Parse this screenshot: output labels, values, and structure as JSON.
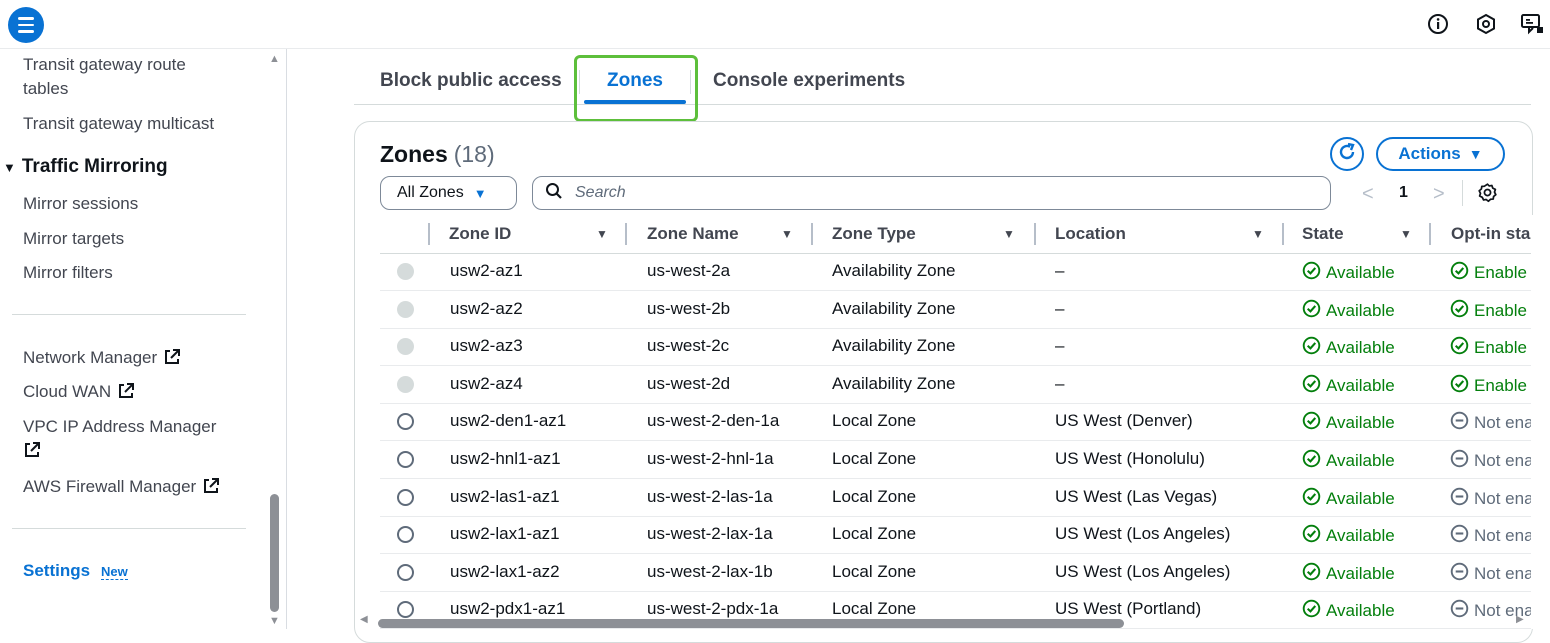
{
  "sidebar": {
    "links_top": [
      {
        "label_line1": "Transit gateway route",
        "label_line2": "tables"
      },
      {
        "label": "Transit gateway multicast"
      }
    ],
    "section": {
      "label": "Traffic Mirroring",
      "caret": "▼"
    },
    "section_items": [
      "Mirror sessions",
      "Mirror targets",
      "Mirror filters"
    ],
    "external_links": [
      {
        "label": "Network Manager"
      },
      {
        "label": "Cloud WAN"
      },
      {
        "label": "VPC IP Address Manager"
      },
      {
        "label": "AWS Firewall Manager"
      }
    ],
    "settings_label": "Settings",
    "settings_badge": "New"
  },
  "tabs": [
    {
      "label": "Block public access",
      "active": false
    },
    {
      "label": "Zones",
      "active": true
    },
    {
      "label": "Console experiments",
      "active": false
    }
  ],
  "panel": {
    "title": "Zones",
    "count": "(18)",
    "actions_label": "Actions",
    "actions_caret": "▼",
    "filter_selected": "All Zones",
    "filter_caret": "▼",
    "search_placeholder": "Search",
    "page_number": "1",
    "prev_glyph": "<",
    "next_glyph": ">"
  },
  "table": {
    "columns": [
      "Zone ID",
      "Zone Name",
      "Zone Type",
      "Location",
      "State",
      "Opt-in sta"
    ],
    "sort_glyph": "▼",
    "rows": [
      {
        "zone_id": "usw2-az1",
        "zone_name": "us-west-2a",
        "zone_type": "Availability Zone",
        "location": "–",
        "state": "Available",
        "opt_in": "Enable",
        "selectable": false,
        "opt_in_enabled": true
      },
      {
        "zone_id": "usw2-az2",
        "zone_name": "us-west-2b",
        "zone_type": "Availability Zone",
        "location": "–",
        "state": "Available",
        "opt_in": "Enable",
        "selectable": false,
        "opt_in_enabled": true
      },
      {
        "zone_id": "usw2-az3",
        "zone_name": "us-west-2c",
        "zone_type": "Availability Zone",
        "location": "–",
        "state": "Available",
        "opt_in": "Enable",
        "selectable": false,
        "opt_in_enabled": true
      },
      {
        "zone_id": "usw2-az4",
        "zone_name": "us-west-2d",
        "zone_type": "Availability Zone",
        "location": "–",
        "state": "Available",
        "opt_in": "Enable",
        "selectable": false,
        "opt_in_enabled": true
      },
      {
        "zone_id": "usw2-den1-az1",
        "zone_name": "us-west-2-den-1a",
        "zone_type": "Local Zone",
        "location": "US West (Denver)",
        "state": "Available",
        "opt_in": "Not ena",
        "selectable": true,
        "opt_in_enabled": false
      },
      {
        "zone_id": "usw2-hnl1-az1",
        "zone_name": "us-west-2-hnl-1a",
        "zone_type": "Local Zone",
        "location": "US West (Honolulu)",
        "state": "Available",
        "opt_in": "Not ena",
        "selectable": true,
        "opt_in_enabled": false
      },
      {
        "zone_id": "usw2-las1-az1",
        "zone_name": "us-west-2-las-1a",
        "zone_type": "Local Zone",
        "location": "US West (Las Vegas)",
        "state": "Available",
        "opt_in": "Not ena",
        "selectable": true,
        "opt_in_enabled": false
      },
      {
        "zone_id": "usw2-lax1-az1",
        "zone_name": "us-west-2-lax-1a",
        "zone_type": "Local Zone",
        "location": "US West (Los Angeles)",
        "state": "Available",
        "opt_in": "Not ena",
        "selectable": true,
        "opt_in_enabled": false
      },
      {
        "zone_id": "usw2-lax1-az2",
        "zone_name": "us-west-2-lax-1b",
        "zone_type": "Local Zone",
        "location": "US West (Los Angeles)",
        "state": "Available",
        "opt_in": "Not ena",
        "selectable": true,
        "opt_in_enabled": false
      },
      {
        "zone_id": "usw2-pdx1-az1",
        "zone_name": "us-west-2-pdx-1a",
        "zone_type": "Local Zone",
        "location": "US West (Portland)",
        "state": "Available",
        "opt_in": "Not ena",
        "selectable": true,
        "opt_in_enabled": false
      }
    ]
  },
  "colors": {
    "accent": "#0972d3",
    "success": "#037f0c",
    "highlight": "#5dbf3b",
    "muted": "#5f6b7a"
  },
  "icons": {
    "topbar": [
      "menu-icon",
      "info-icon",
      "notifications-icon",
      "feedback-icon"
    ],
    "panel": [
      "refresh-icon",
      "search-icon",
      "settings-gear-icon"
    ],
    "status": [
      "check-circle-icon",
      "minus-circle-icon"
    ],
    "external": "external-link-icon"
  }
}
